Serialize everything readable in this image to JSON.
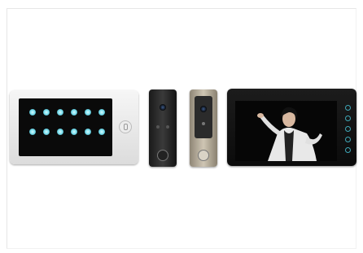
{
  "image": {
    "background_color": "#ffffff",
    "products": [
      {
        "name": "white-indoor-monitor",
        "screen_icon_count": 12,
        "icon_color": "#6fd9ea"
      },
      {
        "name": "black-door-station"
      },
      {
        "name": "silver-door-station"
      },
      {
        "name": "black-indoor-monitor"
      }
    ]
  }
}
